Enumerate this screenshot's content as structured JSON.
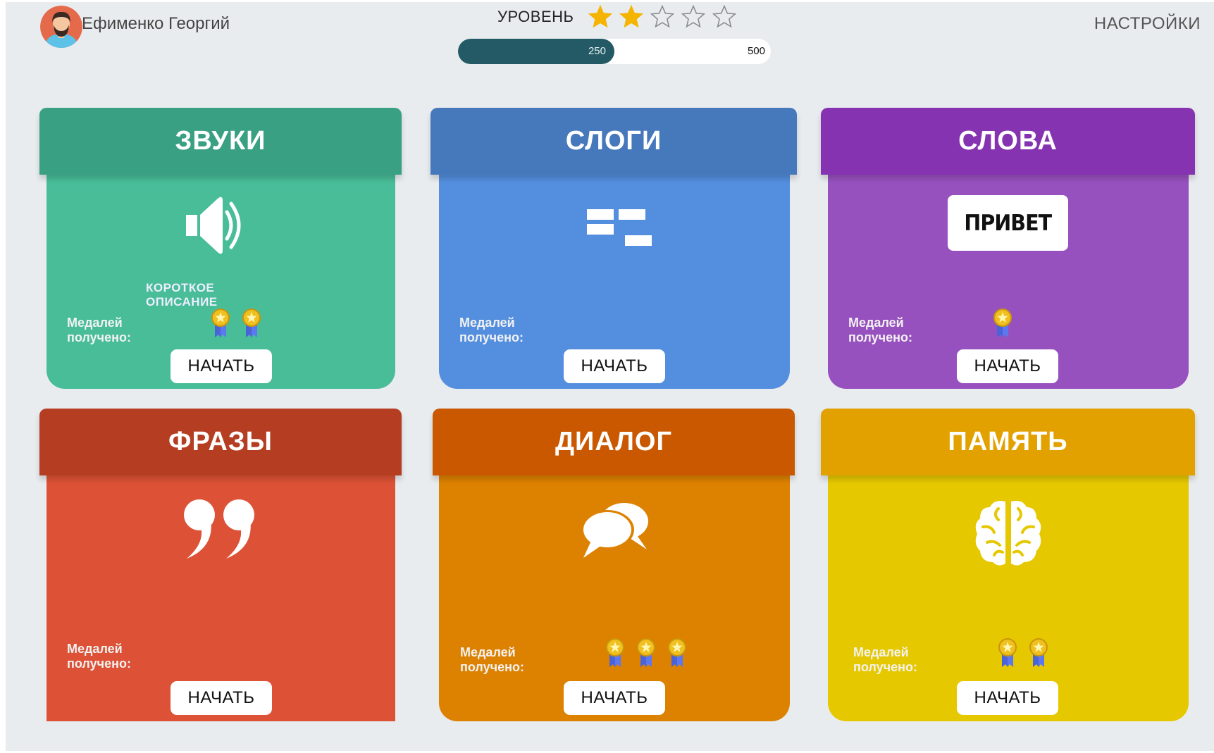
{
  "user": {
    "name": "Ефименко Георгий"
  },
  "level": {
    "label": "УРОВЕНЬ",
    "stars_filled": 2,
    "stars_total": 5,
    "progress_current": "250",
    "progress_max": "500",
    "progress_fraction": 0.5
  },
  "settings_label": "НАСТРОЙКИ",
  "cards": [
    {
      "title": "ЗВУКИ",
      "description": "КОРОТКОЕ ОПИСАНИЕ",
      "medals_label": "Медалей получено:",
      "medals": 2,
      "button": "НАЧАТЬ",
      "icon": "speaker-icon",
      "header_color": "#3aa083",
      "body_color": "#48bd98"
    },
    {
      "title": "СЛОГИ",
      "description": "",
      "medals_label": "Медалей получено:",
      "medals": 0,
      "button": "НАЧАТЬ",
      "icon": "syllables-icon",
      "header_color": "#4678bc",
      "body_color": "#548fdf"
    },
    {
      "title": "СЛОВА",
      "description": "",
      "medals_label": "Медалей получено:",
      "medals": 1,
      "button": "НАЧАТЬ",
      "icon": "word-card-icon",
      "icon_text": "ПРИВЕТ",
      "header_color": "#8533b0",
      "body_color": "#9751bf"
    },
    {
      "title": "ФРАЗЫ",
      "description": "",
      "medals_label": "Медалей получено:",
      "medals": 0,
      "button": "НАЧАТЬ",
      "icon": "quote-icon",
      "header_color": "#b53e22",
      "body_color": "#dd5236"
    },
    {
      "title": "ДИАЛОГ",
      "description": "",
      "medals_label": "Медалей получено:",
      "medals": 3,
      "button": "НАЧАТЬ",
      "icon": "chat-bubbles-icon",
      "header_color": "#c95800",
      "body_color": "#dd8100"
    },
    {
      "title": "ПАМЯТЬ",
      "description": "",
      "medals_label": "Медалей получено:",
      "medals": 2,
      "button": "НАЧАТЬ",
      "icon": "brain-icon",
      "header_color": "#e3a100",
      "body_color": "#e6c800"
    }
  ]
}
